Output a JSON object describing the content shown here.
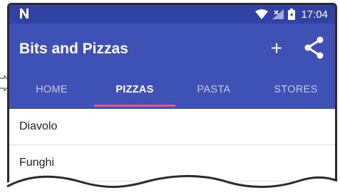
{
  "status_bar": {
    "time": "17:04",
    "icons": [
      "n-notification-icon",
      "wifi-icon",
      "signal-icon",
      "battery-icon"
    ]
  },
  "app_bar": {
    "title": "Bits and Pizzas",
    "add_label": "+",
    "actions": [
      "add-icon",
      "share-icon"
    ]
  },
  "tabs": [
    {
      "label": "HOME",
      "selected": false
    },
    {
      "label": "PIZZAS",
      "selected": true
    },
    {
      "label": "PASTA",
      "selected": false
    },
    {
      "label": "STORES",
      "selected": false
    }
  ],
  "list": {
    "items": [
      {
        "label": "Diavolo"
      },
      {
        "label": "Funghi"
      }
    ]
  },
  "colors": {
    "status_bar": "#3042a4",
    "primary": "#3f51b5",
    "tab_indicator": "#e0578b",
    "tab_text_unselected": "#c6cbea"
  }
}
